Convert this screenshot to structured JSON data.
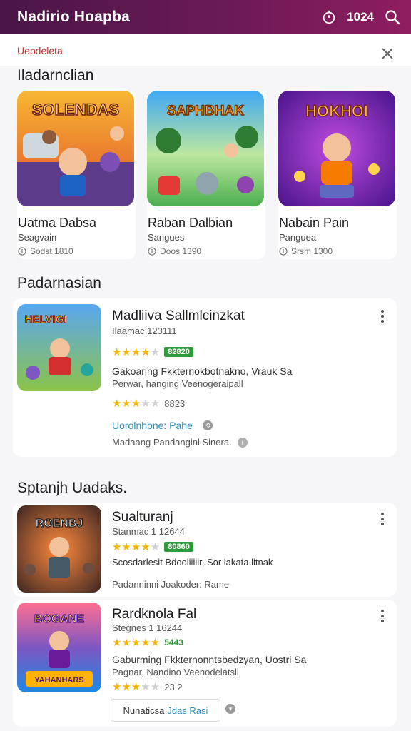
{
  "header": {
    "title": "Nadirio Hoapba",
    "counter": "1024"
  },
  "subheader": {
    "label": "Uepdeleta"
  },
  "sections": {
    "featured": "Iladarnclian",
    "popular": "Padarnasian",
    "spotlight": "Sptanjh Uadaks."
  },
  "featured": [
    {
      "name": "Uatma Dabsa",
      "genre": "Seagvain",
      "meta": "Sodst 1810",
      "art": "SOLENDAS"
    },
    {
      "name": "Raban Dalbian",
      "genre": "Sangues",
      "meta": "Doos 1390",
      "art": "SAPHBHAK"
    },
    {
      "name": "Nabain Pain",
      "genre": "Panguea",
      "meta": "Srsm 1300",
      "art": "HOKHOI"
    }
  ],
  "popular_item": {
    "title": "Madliiva Sallmlcinzkat",
    "subtitle": "Ilaamac 123111",
    "rating_label": "82820",
    "desc": "Gakoaring Fkkternokbotnakno, Vrauk Sa",
    "desc2": "Perwar, hanging Veenogeraipall",
    "rating2": "8823",
    "link": "Uorolnhbne: Pahe",
    "footer": "Madaang Pandanginl Sinera.",
    "art": "HELVIGI"
  },
  "spotlight_items": [
    {
      "title": "Sualturanj",
      "subtitle": "Stanmac 1 12644",
      "rating_label": "80860",
      "desc": "Scosdarlesit Bdooliiiiir, Sor lakata litnak",
      "footer": "Padanninni Joakoder: Rame",
      "art": "ROENBJ"
    },
    {
      "title": "Rardknola Fal",
      "subtitle": "Stegnes 1 16244",
      "rating_label": "5443",
      "desc": "Gaburming Fkkternonntsbedzyan, Uostri Sa",
      "desc2": "Pagnar, Nandino Veenodelatsll",
      "rating2": "23.2",
      "art": "YAHANHARS"
    }
  ],
  "bottom_button": {
    "label": "Nunaticsa",
    "accent": "Jdas Rasi"
  },
  "colors": {
    "header_start": "#4a1547",
    "header_end": "#8e1d5f",
    "accent_red": "#c62828",
    "link": "#2a8fbd",
    "star": "#f4b400",
    "badge": "#2e9a3a"
  }
}
